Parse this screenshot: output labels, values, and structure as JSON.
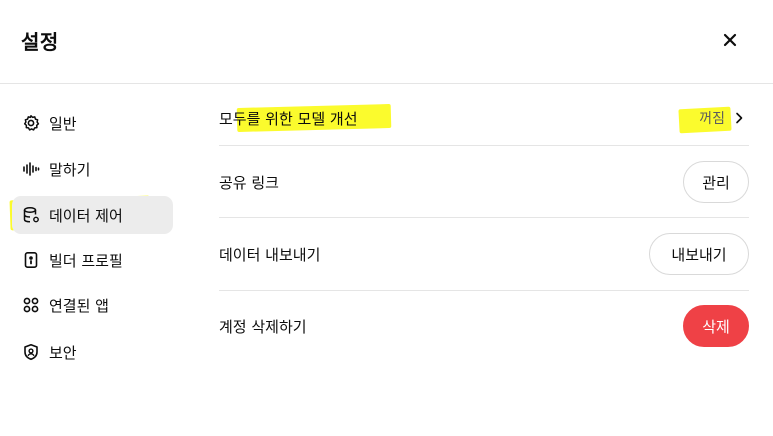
{
  "dialog": {
    "title": "설정",
    "close_label": "×"
  },
  "sidebar": {
    "items": [
      {
        "label": "일반",
        "icon": "gear-icon"
      },
      {
        "label": "말하기",
        "icon": "audio-wave-icon"
      },
      {
        "label": "데이터 제어",
        "icon": "database-icon",
        "active": true
      },
      {
        "label": "빌더 프로필",
        "icon": "id-badge-icon"
      },
      {
        "label": "연결된 앱",
        "icon": "apps-grid-icon"
      },
      {
        "label": "보안",
        "icon": "shield-icon"
      }
    ]
  },
  "settings": {
    "improve_model": {
      "label": "모두를 위한 모델 개선",
      "value": "꺼짐",
      "icon": "chevron-right-icon"
    },
    "shared_links": {
      "label": "공유 링크",
      "button": "관리"
    },
    "export_data": {
      "label": "데이터 내보내기",
      "button": "내보내기"
    },
    "delete_account": {
      "label": "계정 삭제하기",
      "button": "삭제"
    }
  },
  "colors": {
    "danger": "#ef4146",
    "highlight": "#fbfb2d",
    "active_bg": "#ececec"
  }
}
